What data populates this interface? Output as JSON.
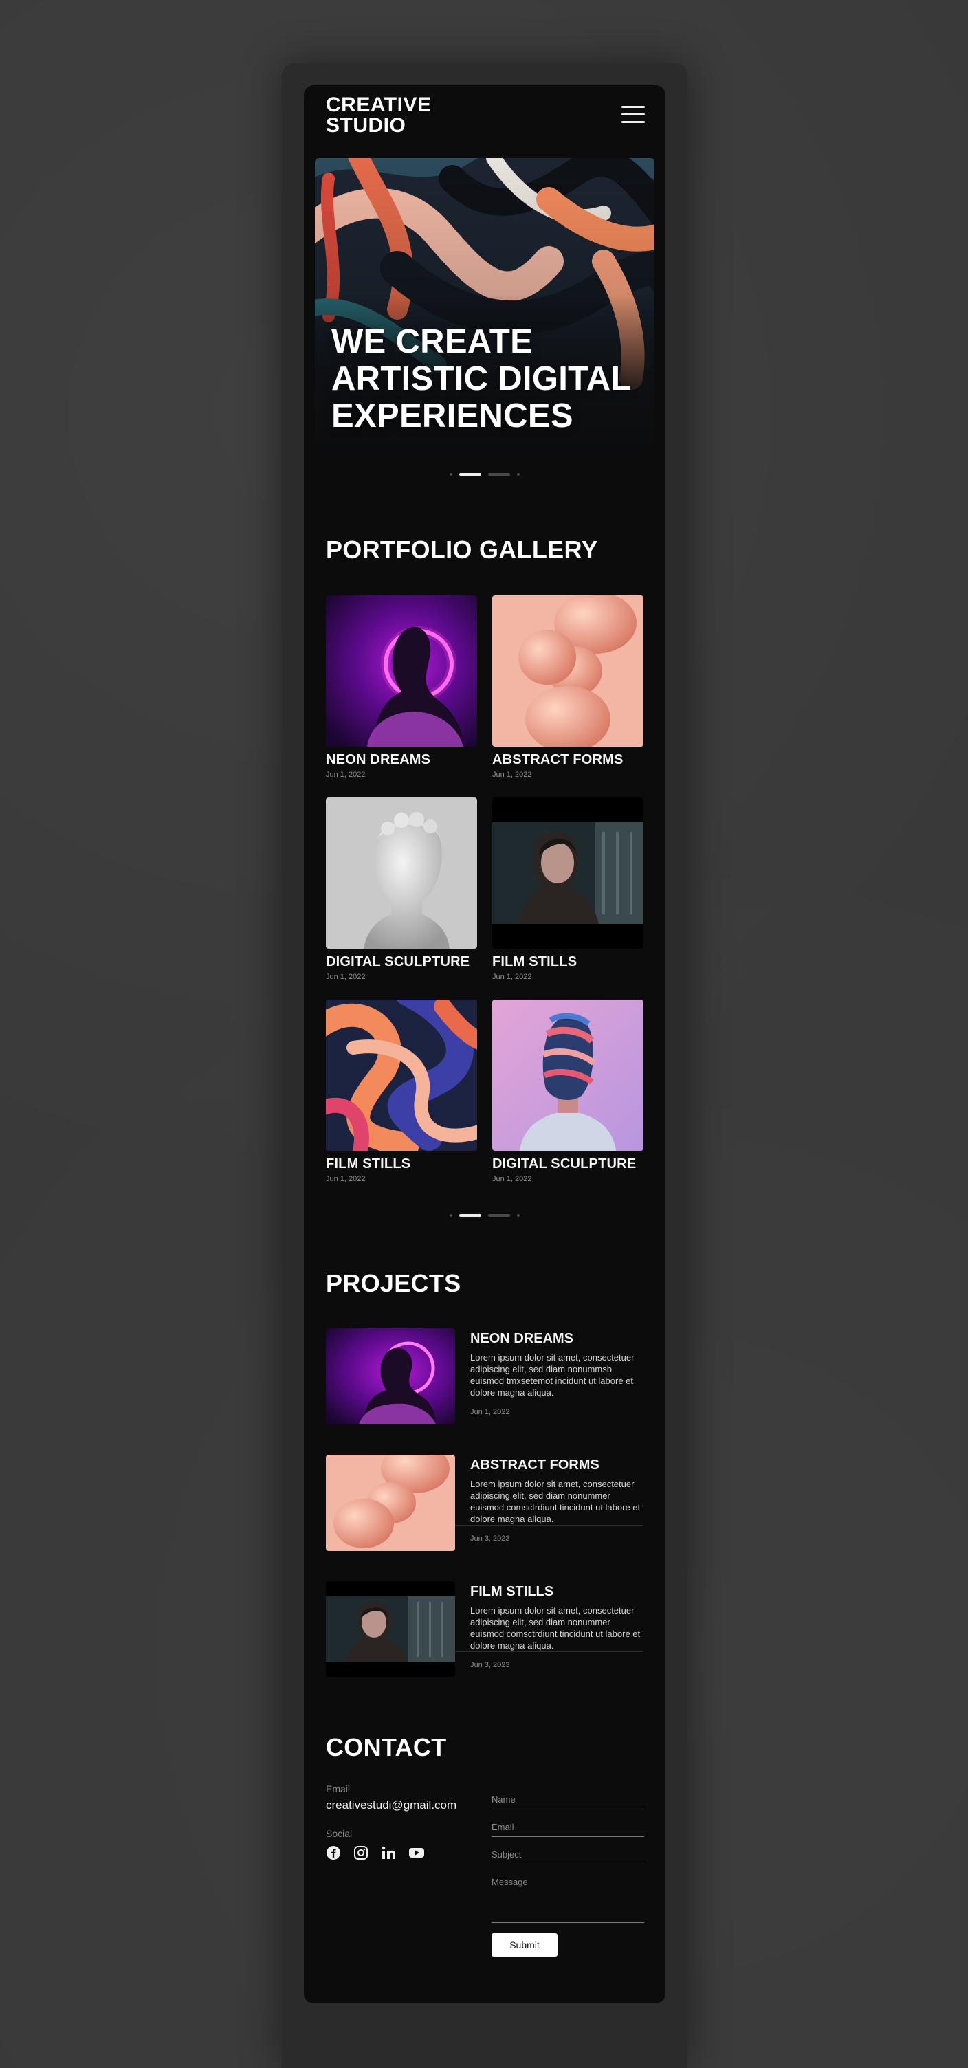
{
  "header": {
    "logo_line1": "CREATIVE",
    "logo_line2": "STUDIO",
    "menu_icon": "hamburger-menu-icon"
  },
  "hero": {
    "title": "WE CREATE ARTISTIC DIGITAL EXPERIENCES",
    "slide_count": 4,
    "active_slide": 2
  },
  "gallery": {
    "title": "PORTFOLIO GALLERY",
    "items": [
      {
        "title": "NEON DREAMS",
        "date": "Jun 1, 2022"
      },
      {
        "title": "ABSTRACT FORMS",
        "date": "Jun 1, 2022"
      },
      {
        "title": "DIGITAL SCULPTURE",
        "date": "Jun 1, 2022"
      },
      {
        "title": "FILM STILLS",
        "date": "Jun 1, 2022"
      },
      {
        "title": "FILM STILLS",
        "date": "Jun 1, 2022"
      },
      {
        "title": "DIGITAL SCULPTURE",
        "date": "Jun 1, 2022"
      }
    ],
    "slide_count": 4,
    "active_slide": 2
  },
  "projects": {
    "title": "PROJECTS",
    "items": [
      {
        "title": "NEON DREAMS",
        "description": "Lorem ipsum dolor sit amet, consectetuer adipiscing elit, sed diam nonummsb euismod tmxsetemot incidunt ut labore et dolore magna aliqua.",
        "date": "Jun 1, 2022"
      },
      {
        "title": "ABSTRACT FORMS",
        "description": "Lorem ipsum dolor sit amet, consectetuer adipiscing elit, sed diam nonummer euismod comsctrdiunt tincidunt ut labore et dolore magna aliqua.",
        "date": "Jun 3, 2023"
      },
      {
        "title": "FILM STILLS",
        "description": "Lorem ipsum dolor sit amet, consectetuer adipiscing elit, sed diam nonummer euismod comsctrdiunt tincidunt ut labore et dolore magna aliqua.",
        "date": "Jun 3, 2023"
      }
    ]
  },
  "contact": {
    "title": "CONTACT",
    "email_label": "Email",
    "email": "creativestudi@gmail.com",
    "social_label": "Social",
    "social_icons": [
      "facebook-icon",
      "instagram-icon",
      "linkedin-icon",
      "youtube-icon"
    ],
    "form": {
      "name_placeholder": "Name",
      "email_placeholder": "Email",
      "subject_placeholder": "Subject",
      "message_placeholder": "Message",
      "submit_label": "Submit"
    }
  },
  "colors": {
    "page_bg": "#393939",
    "screen_bg": "#0c0c0d",
    "text": "#f2f2f2",
    "muted": "#8c8c8c",
    "neon_accent": "#e040fb",
    "peach_accent": "#f2a48a"
  }
}
